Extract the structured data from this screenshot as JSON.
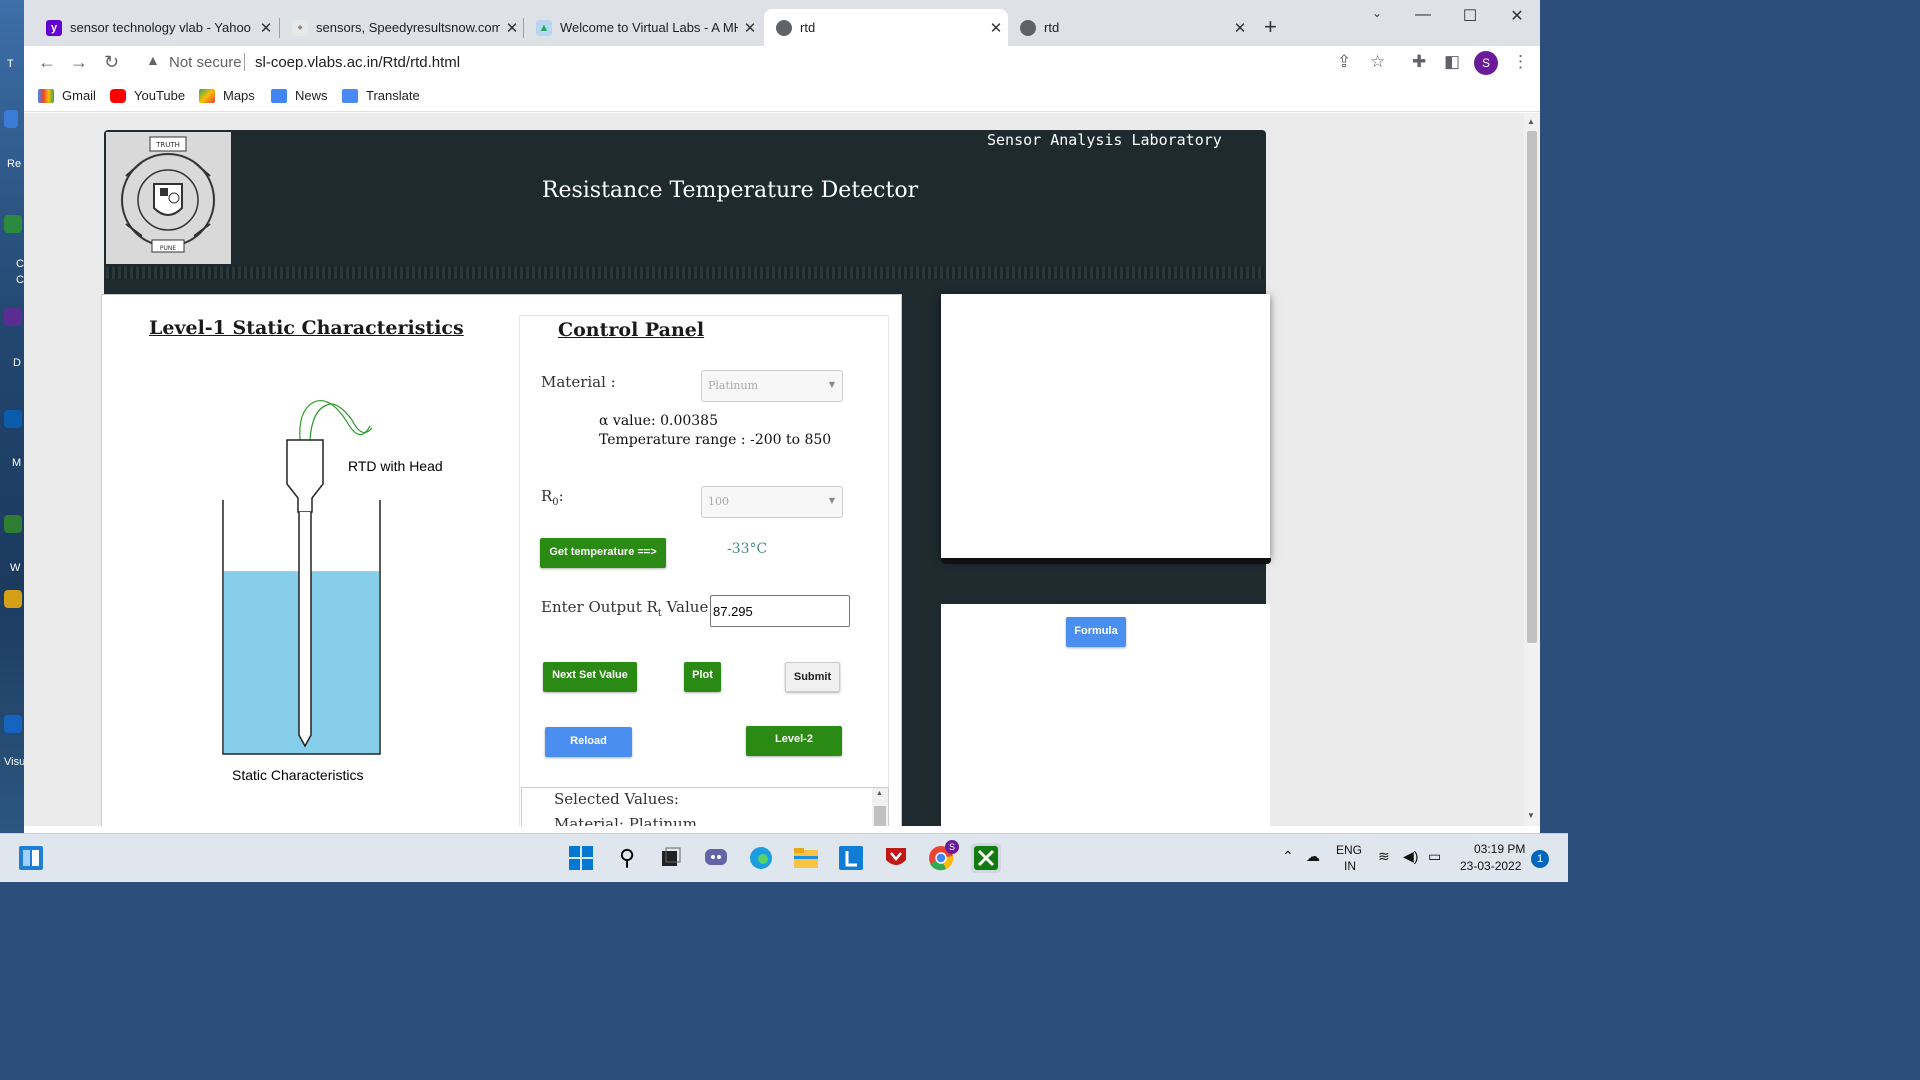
{
  "browser": {
    "tabs": [
      {
        "title": "sensor technology vlab - Yahoo I",
        "favicon": "yahoo-icon",
        "active": false
      },
      {
        "title": "sensors, Speedyresultsnow.com",
        "favicon": "speedy-results-icon",
        "active": false
      },
      {
        "title": "Welcome to Virtual Labs - A MHR",
        "favicon": "virtual-labs-icon",
        "active": false
      },
      {
        "title": "rtd",
        "favicon": "globe-icon",
        "active": true
      },
      {
        "title": "rtd",
        "favicon": "globe-icon",
        "active": false
      }
    ],
    "security_label": "Not secure",
    "url": "sl-coep.vlabs.ac.in/Rtd/rtd.html",
    "profile_initial": "S",
    "bookmarks": [
      "Gmail",
      "YouTube",
      "Maps",
      "News",
      "Translate"
    ]
  },
  "desktop": {
    "labels": [
      "T",
      "Re",
      "C",
      "C",
      "D",
      "M",
      "W",
      "Visu"
    ]
  },
  "header": {
    "lab_name": "Sensor Analysis Laboratory",
    "title": "Resistance Temperature Detector",
    "logo_lettering": [
      "TRUTH",
      "STRENGTH",
      "ENDURANCE",
      "COLLEGE OF",
      "ENGINEERING",
      "PUNE"
    ]
  },
  "left_panel": {
    "title": "Level-1 Static Characteristics",
    "rtd_label": "RTD with Head",
    "caption": "Static Characteristics",
    "liquid_level": 0.72
  },
  "control_panel": {
    "title": "Control Panel",
    "material_label": "Material :",
    "material_value": "Platinum",
    "alpha_text": "α value: 0.00385",
    "range_text": "Temperature range : -200 to 850",
    "r0_label": "R",
    "r0_sub": "0",
    "r0_suffix": ":",
    "r0_value": "100",
    "get_temp_button": "Get temperature ==>",
    "temperature": "-33°C",
    "rt_label_prefix": "Enter Output R",
    "rt_label_sub": "t",
    "rt_label_suffix": " Value :",
    "rt_value": "87.295",
    "next_button": "Next Set Value",
    "plot_button": "Plot",
    "submit_button": "Submit",
    "reload_button": "Reload",
    "level2_button": "Level-2",
    "selected_values_title": "Selected Values:",
    "selected_material_partial": "Material: Platinum"
  },
  "right_panel": {
    "formula_button": "Formula"
  },
  "taskbar": {
    "lang": "ENG",
    "region": "IN",
    "time": "03:19 PM",
    "date": "23-03-2022",
    "notifications": "1",
    "chrome_badge": "S"
  },
  "colors": {
    "header_bg": "#1e2a2e",
    "green_button": "#2a8a14",
    "blue_button": "#4a8ef0",
    "liquid": "#87ceeb",
    "temp_text": "#4a8a8a"
  }
}
